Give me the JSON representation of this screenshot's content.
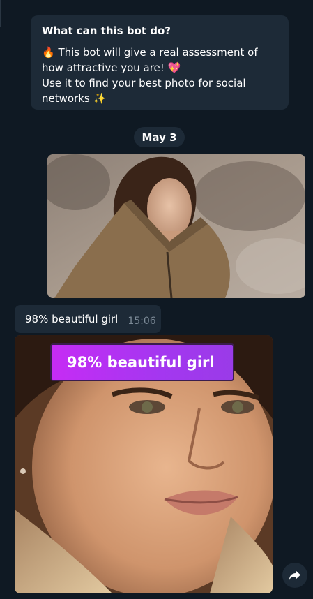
{
  "bot_intro": {
    "title": "What can this bot do?",
    "line1": "🔥 This bot will give a real assessment of how attractive you are! 💖",
    "line2": "Use it to find your best photo for social networks ✨"
  },
  "date_separator": "May 3",
  "messages": [
    {
      "type": "photo",
      "direction": "outgoing",
      "content": "photo"
    },
    {
      "type": "text",
      "direction": "incoming",
      "text": "98% beautiful girl",
      "time": "15:06"
    },
    {
      "type": "photo",
      "direction": "incoming",
      "overlay_label": "98% beautiful girl"
    }
  ],
  "icons": {
    "forward": "forward-arrow-icon"
  },
  "colors": {
    "background": "#0f1923",
    "bubble": "#1d2a37",
    "badge": "#b535f2",
    "timestamp": "#7c8a97"
  }
}
